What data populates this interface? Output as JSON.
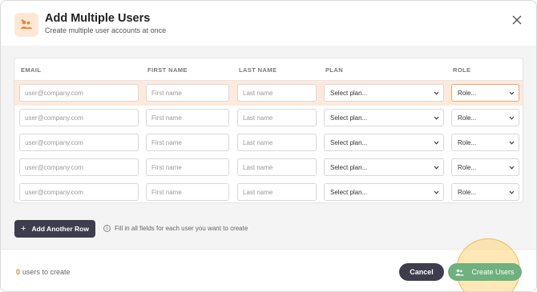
{
  "modal": {
    "title": "Add Multiple Users",
    "subtitle": "Create multiple user accounts at once"
  },
  "table": {
    "headers": [
      "EMAIL",
      "FIRST NAME",
      "LAST NAME",
      "PLAN",
      "ROLE"
    ],
    "rows": [
      {
        "email_placeholder": "user@company.com",
        "first_placeholder": "First name",
        "last_placeholder": "Last name",
        "plan": "Select plan...",
        "role": "Role..."
      },
      {
        "email_placeholder": "user@company.com",
        "first_placeholder": "First name",
        "last_placeholder": "Last name",
        "plan": "Select plan...",
        "role": "Role..."
      },
      {
        "email_placeholder": "user@company.com",
        "first_placeholder": "First name",
        "last_placeholder": "Last name",
        "plan": "Select plan...",
        "role": "Role..."
      },
      {
        "email_placeholder": "user@company.com",
        "first_placeholder": "First name",
        "last_placeholder": "Last name",
        "plan": "Select plan...",
        "role": "Role..."
      },
      {
        "email_placeholder": "user@company.com",
        "first_placeholder": "First name",
        "last_placeholder": "Last name",
        "plan": "Select plan...",
        "role": "Role..."
      }
    ]
  },
  "actions": {
    "add_row_label": "Add Another Row",
    "hint": "Fill in all fields for each user you want to create"
  },
  "footer": {
    "count": "0",
    "count_suffix": "users to create",
    "cancel_label": "Cancel",
    "create_label": "Create Users"
  },
  "colors": {
    "accent": "#e8862e",
    "dark_button": "#3e3d4d",
    "create_button": "#6fb07f",
    "row_highlight": "#fdeadc"
  },
  "icons": {
    "header": "users-add-icon",
    "close": "close-icon",
    "info": "info-icon",
    "create": "users-icon",
    "chevron": "chevron-down-icon"
  }
}
